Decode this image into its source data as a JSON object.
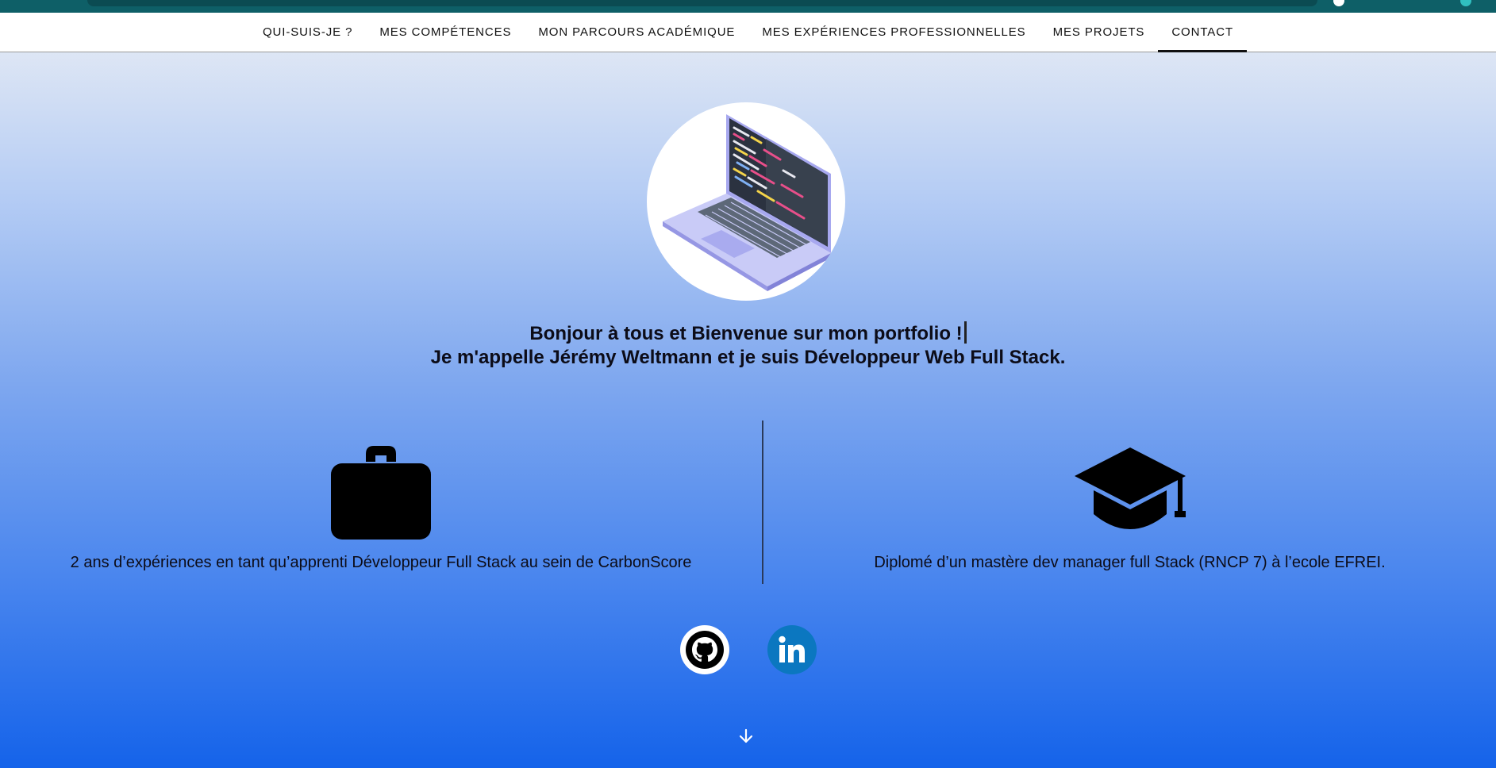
{
  "nav": {
    "items": [
      {
        "label": "QUI-SUIS-JE ?",
        "name": "nav-qui-suis-je"
      },
      {
        "label": "MES COMPÉTENCES",
        "name": "nav-competences"
      },
      {
        "label": "MON PARCOURS ACADÉMIQUE",
        "name": "nav-parcours"
      },
      {
        "label": "MES EXPÉRIENCES PROFESSIONNELLES",
        "name": "nav-experiences"
      },
      {
        "label": "MES PROJETS",
        "name": "nav-projets"
      },
      {
        "label": "CONTACT",
        "name": "nav-contact"
      }
    ],
    "active_index": 5
  },
  "hero": {
    "image_icon": "laptop-code-illustration",
    "greeting_line1": "Bonjour à tous et Bienvenue sur mon portfolio !",
    "greeting_line2": "Je m'appelle Jérémy Weltmann et je suis Développeur Web Full Stack."
  },
  "highlights": {
    "experience": {
      "icon": "briefcase-icon",
      "text": "2 ans d’expériences en tant qu’apprenti Développeur Full Stack au sein de CarbonScore"
    },
    "education": {
      "icon": "graduation-cap-icon",
      "text": "Diplomé d’un mastère dev manager full Stack (RNCP 7) à l’ecole EFREI."
    }
  },
  "socials": {
    "github_icon": "github-icon",
    "linkedin_icon": "linkedin-icon",
    "linkedin_color": "#0b77c0"
  },
  "colors": {
    "browser_bar": "#0e5f67",
    "gradient_top": "#eceff5",
    "gradient_bottom": "#1563ea",
    "text": "#0c0c18"
  },
  "scroll_icon": "arrow-down-icon"
}
